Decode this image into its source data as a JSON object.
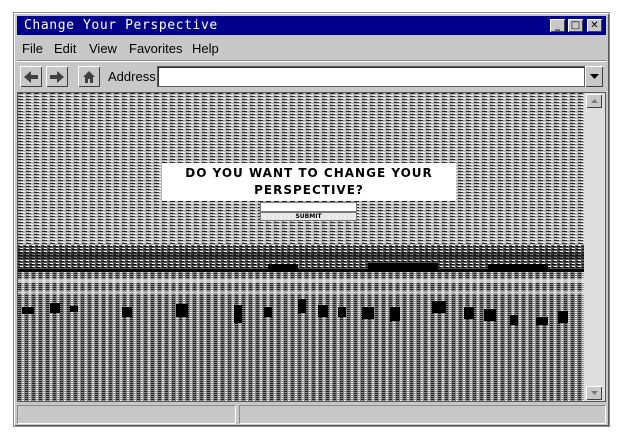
{
  "window": {
    "title": "Change Your Perspective"
  },
  "title_buttons": {
    "minimize": "_",
    "maximize": "□",
    "close": "✕"
  },
  "menu": [
    "File",
    "Edit",
    "View",
    "Favorites",
    "Help"
  ],
  "toolbar": {
    "back_icon": "back-arrow-icon",
    "forward_icon": "forward-arrow-icon",
    "home_icon": "home-icon",
    "address_label": "Address:",
    "address_value": ""
  },
  "page": {
    "question_line1": "DO YOU WANT TO CHANGE YOUR",
    "question_line2": "PERSPECTIVE?",
    "answer_value": "",
    "submit_label": "SUBMIT"
  },
  "status": {
    "left": "",
    "right": ""
  },
  "colors": {
    "titlebar": "#00008a",
    "chrome": "#c8c8c8"
  }
}
